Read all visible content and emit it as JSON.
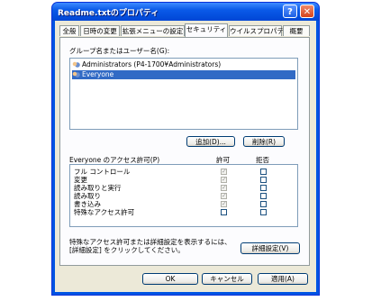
{
  "window": {
    "title": "Readme.txtのプロパティ",
    "help_label": "?",
    "close_label": "✕"
  },
  "tabs": [
    {
      "label": "全般",
      "active": false
    },
    {
      "label": "日時の変更",
      "active": false
    },
    {
      "label": "拡張メニューの設定",
      "active": false
    },
    {
      "label": "セキュリティ",
      "active": true
    },
    {
      "label": "ウイルスプロパティ",
      "active": false
    },
    {
      "label": "概要",
      "active": false
    }
  ],
  "security": {
    "group_label": "グループ名またはユーザー名(G):",
    "users": [
      {
        "name": "Administrators (P4-1700¥Administrators)",
        "selected": false,
        "icon": "users-icon"
      },
      {
        "name": "Everyone",
        "selected": true,
        "icon": "users-icon"
      }
    ],
    "add_button": "追加(D)...",
    "remove_button": "削除(R)",
    "perm_header": "Everyone のアクセス許可(P)",
    "allow_header": "許可",
    "deny_header": "拒否",
    "permissions": [
      {
        "name": "フル コントロール",
        "allow": false,
        "deny": false
      },
      {
        "name": "変更",
        "allow": false,
        "deny": false
      },
      {
        "name": "読み取りと実行",
        "allow": true,
        "deny": false
      },
      {
        "name": "読み取り",
        "allow": true,
        "deny": false
      },
      {
        "name": "書き込み",
        "allow": false,
        "deny": false
      },
      {
        "name": "特殊なアクセス許可",
        "allow": false,
        "deny": false
      }
    ],
    "advanced_note": "特殊なアクセス許可または詳細設定を表示するには、[詳細設定] をクリックしてください。",
    "advanced_button": "詳細設定(V)"
  },
  "footer": {
    "ok": "OK",
    "cancel": "キャンセル",
    "apply": "適用(A)"
  }
}
